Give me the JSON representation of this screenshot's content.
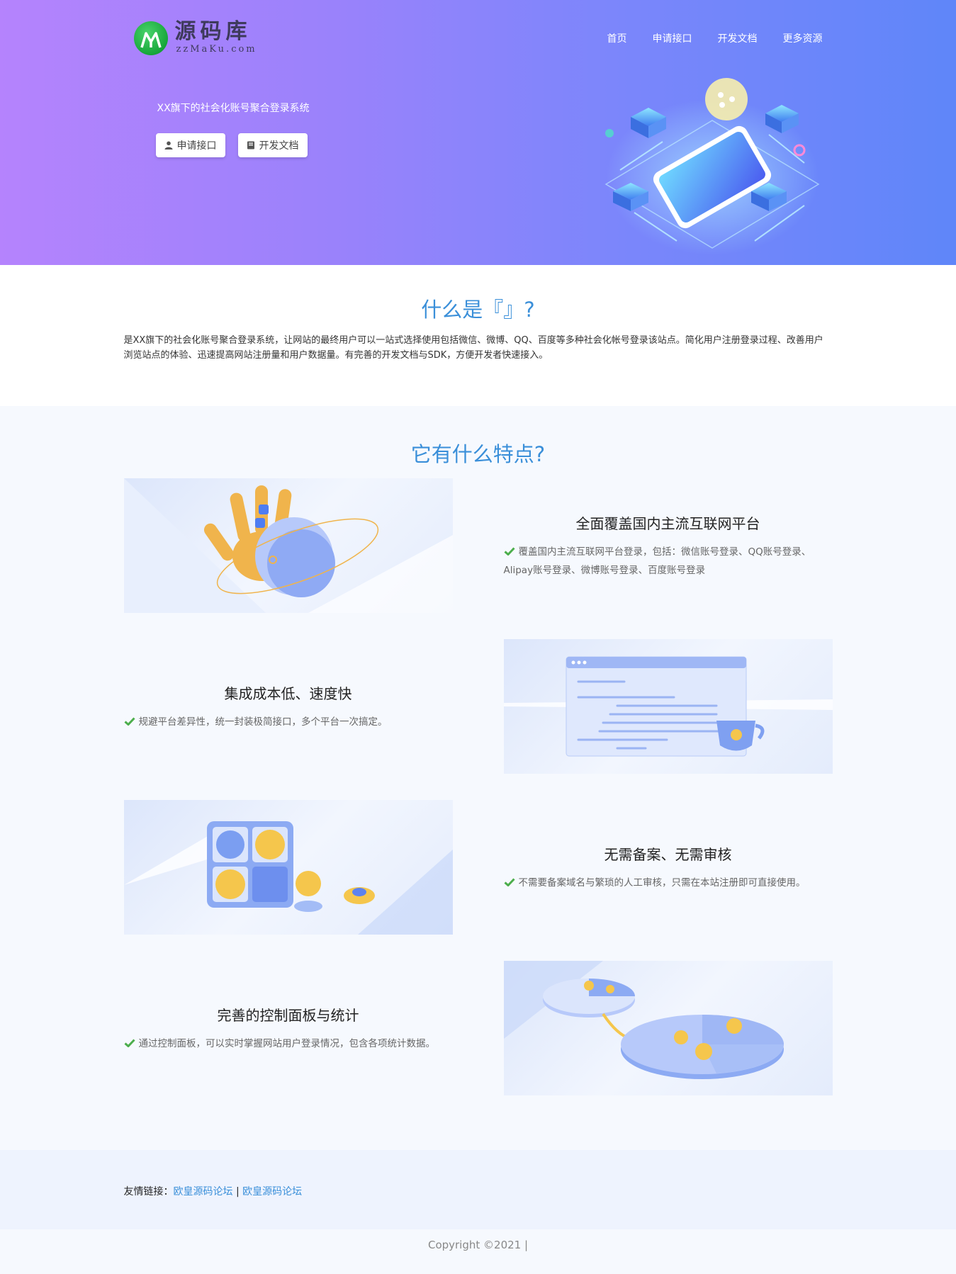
{
  "logo": {
    "cn": "源码库",
    "en": "zzMaKu.com"
  },
  "nav": [
    "首页",
    "申请接口",
    "开发文档",
    "更多资源"
  ],
  "hero": {
    "slogan": "XX旗下的社会化账号聚合登录系统",
    "buttons": [
      {
        "label": "申请接口",
        "icon": "user-icon"
      },
      {
        "label": "开发文档",
        "icon": "book-icon"
      }
    ]
  },
  "about": {
    "title": "什么是『』?",
    "desc": "是XX旗下的社会化账号聚合登录系统，让网站的最终用户可以一站式选择使用包括微信、微博、QQ、百度等多种社会化帐号登录该站点。简化用户注册登录过程、改善用户浏览站点的体验、迅速提高网站注册量和用户数据量。有完善的开发文档与SDK，方便开发者快速接入。"
  },
  "features": {
    "title": "它有什么特点?",
    "items": [
      {
        "title": "全面覆盖国内主流互联网平台",
        "desc": "覆盖国内主流互联网平台登录，包括：微信账号登录、QQ账号登录、Alipay账号登录、微博账号登录、百度账号登录"
      },
      {
        "title": "集成成本低、速度快",
        "desc": "规避平台差异性，统一封装极简接口，多个平台一次搞定。"
      },
      {
        "title": "无需备案、无需审核",
        "desc": "不需要备案域名与繁琐的人工审核，只需在本站注册即可直接使用。"
      },
      {
        "title": "完善的控制面板与统计",
        "desc": "通过控制面板，可以实时掌握网站用户登录情况，包含各项统计数据。"
      }
    ]
  },
  "footer": {
    "links_label": "友情链接：",
    "links": [
      "欧皇源码论坛",
      "欧皇源码论坛"
    ],
    "separator": "|",
    "copyright": "Copyright ©2021 |"
  },
  "colors": {
    "accent": "#3a8fd9",
    "check": "#4cae4c",
    "hero_start": "#b583fd",
    "hero_end": "#5f86f9"
  }
}
